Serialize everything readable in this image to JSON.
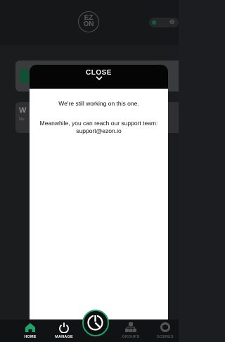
{
  "header": {
    "logo_top": "EZ",
    "logo_bottom": "ON",
    "status_icon": "globe-icon",
    "status_color": "#1f8f5a"
  },
  "background_cards": {
    "card2_title": "W"
  },
  "modal": {
    "close_label": "CLOSE",
    "close_chevron": "⌄",
    "message": "We're still working on this one.",
    "details": "Meanwhile, you can reach our support team: support@ezon.io"
  },
  "nav": {
    "items": [
      {
        "label": "HOME",
        "icon": "home-icon",
        "active": true
      },
      {
        "label": "MANAGE",
        "icon": "power-icon",
        "active": false
      },
      {
        "label": "GROUPS",
        "icon": "groups-icon",
        "active": false
      },
      {
        "label": "SCENES",
        "icon": "scenes-icon",
        "active": false
      }
    ],
    "accent": "#1fa36b"
  }
}
